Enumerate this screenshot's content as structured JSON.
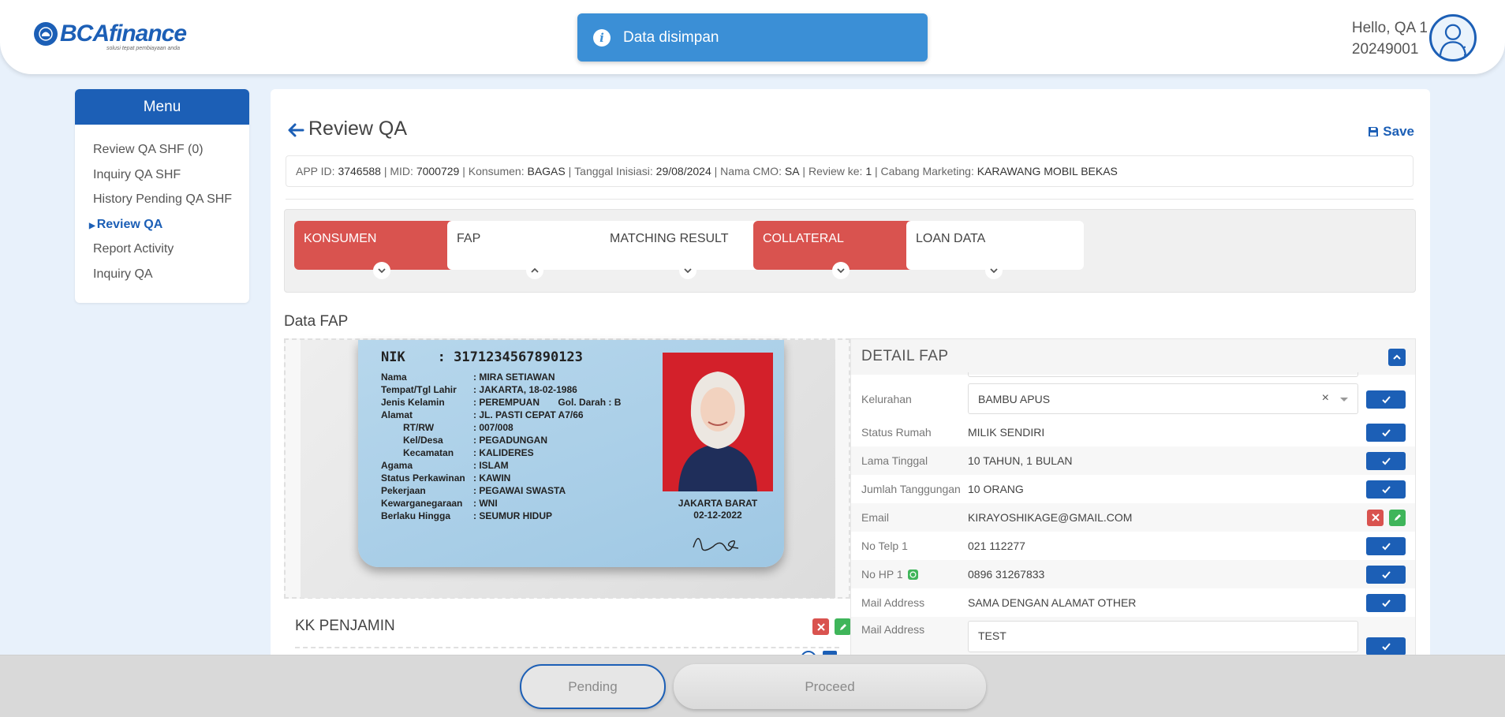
{
  "header": {
    "logo_text": "BCAfinance",
    "logo_tagline": "solusi tepat pembiayaan anda",
    "greeting": "Hello, QA 1",
    "user_id": "20249001",
    "menu_dots": "⋮"
  },
  "toast": {
    "icon": "info-icon",
    "message": "Data disimpan"
  },
  "sidebar": {
    "title": "Menu",
    "items": [
      {
        "label": "Review QA SHF (0)"
      },
      {
        "label": "Inquiry QA SHF"
      },
      {
        "label": "History Pending QA SHF"
      },
      {
        "label": "Review QA",
        "active": true
      },
      {
        "label": "Report Activity"
      },
      {
        "label": "Inquiry QA"
      }
    ]
  },
  "page": {
    "title": "Review QA",
    "save_label": "Save",
    "info": {
      "app_id_label": "APP ID:",
      "app_id": "3746588",
      "mid_label": "MID:",
      "mid": "7000729",
      "konsumen_label": "Konsumen:",
      "konsumen": "BAGAS",
      "tanggal_label": "Tanggal Inisiasi:",
      "tanggal": "29/08/2024",
      "cmo_label": "Nama CMO:",
      "cmo": "SA",
      "review_label": "Review ke:",
      "review": "1",
      "cabang_label": "Cabang Marketing:",
      "cabang": "KARAWANG MOBIL BEKAS"
    }
  },
  "tabs": [
    {
      "label": "KONSUMEN",
      "status": "red",
      "chevron": "chevron-down-icon"
    },
    {
      "label": "FAP",
      "status": "white",
      "chevron": "chevron-up-icon"
    },
    {
      "label": "MATCHING RESULT",
      "status": "white",
      "chevron": "chevron-down-icon"
    },
    {
      "label": "COLLATERAL",
      "status": "red",
      "chevron": "chevron-down-icon"
    },
    {
      "label": "LOAN DATA",
      "status": "white",
      "chevron": "chevron-down-icon"
    }
  ],
  "section_title": "Data FAP",
  "ktp": {
    "nik_label": "NIK",
    "nik": ": 3171234567890123",
    "rows": [
      {
        "k": "Nama",
        "v": ": MIRA SETIAWAN"
      },
      {
        "k": "Tempat/Tgl Lahir",
        "v": ": JAKARTA, 18-02-1986"
      },
      {
        "k": "Jenis Kelamin",
        "v": ": PEREMPUAN       Gol. Darah : B"
      },
      {
        "k": "Alamat",
        "v": ": JL. PASTI CEPAT A7/66"
      },
      {
        "k": "RT/RW",
        "v": ": 007/008"
      },
      {
        "k": "Kel/Desa",
        "v": ": PEGADUNGAN"
      },
      {
        "k": "Kecamatan",
        "v": ": KALIDERES"
      },
      {
        "k": "Agama",
        "v": ": ISLAM"
      },
      {
        "k": "Status Perkawinan",
        "v": ": KAWIN"
      },
      {
        "k": "Pekerjaan",
        "v": ": PEGAWAI SWASTA"
      },
      {
        "k": "Kewarganegaraan",
        "v": ": WNI"
      },
      {
        "k": "Berlaku Hingga",
        "v": ": SEUMUR HIDUP"
      }
    ],
    "city": "JAKARTA BARAT",
    "date": "02-12-2022"
  },
  "kk_title": "KK PENJAMIN",
  "detail": {
    "title": "DETAIL FAP",
    "rows": [
      {
        "label": "Kelurahan",
        "value": "BAMBU APUS",
        "type": "select",
        "clear": "×"
      },
      {
        "label": "Status Rumah",
        "value": "MILIK SENDIRI"
      },
      {
        "label": "Lama Tinggal",
        "value": "10 TAHUN, 1 BULAN"
      },
      {
        "label": "Jumlah Tanggungan",
        "value": "10 ORANG"
      },
      {
        "label": "Email",
        "value": "KIRAYOSHIKAGE@GMAIL.COM",
        "type": "edit"
      },
      {
        "label": "No Telp 1",
        "value": "021 112277"
      },
      {
        "label": "No HP 1",
        "value": "0896 31267833",
        "whatsapp": true
      },
      {
        "label": "Mail Address",
        "value": "SAMA DENGAN ALAMAT OTHER"
      },
      {
        "label": "Mail Address",
        "value": "TEST",
        "type": "text"
      }
    ]
  },
  "footer": {
    "pending_label": "Pending",
    "proceed_label": "Proceed"
  },
  "colors": {
    "primary": "#1c5fb6",
    "danger": "#d9534f",
    "success": "#3fb55a",
    "toast": "#3b8fd6"
  }
}
